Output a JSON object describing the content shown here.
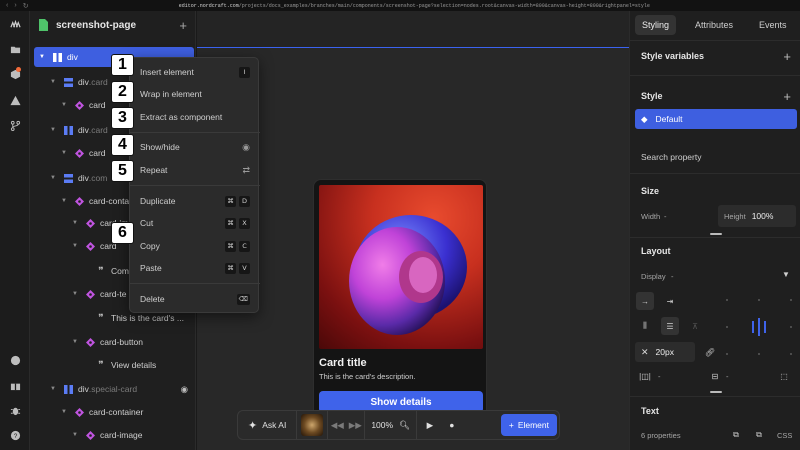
{
  "browser": {
    "url_prefix": "editor.nordcraft.com",
    "url_rest": "/projects/docs_examples/branches/main/components/screenshot-page?selection=nodes.root&canvas-width=800&canvas-height=800&rightpanel=style"
  },
  "rail": {
    "icons": [
      "nordcraft-logo-icon",
      "files-icon",
      "package-icon",
      "warning-icon",
      "branch-icon",
      "theme-icon",
      "gift-icon",
      "bug-icon",
      "help-icon"
    ]
  },
  "tree": {
    "page_name": "screenshot-page",
    "rows": [
      {
        "name": "div",
        "cls": "",
        "sel": true
      },
      {
        "name": "div",
        "cls": ".card"
      },
      {
        "name": "card",
        "cls": ""
      },
      {
        "name": "div",
        "cls": ".card"
      },
      {
        "name": "card",
        "cls": ""
      },
      {
        "name": "div",
        "cls": ".com"
      },
      {
        "name": "card-conta",
        "cls": ""
      },
      {
        "name": "card-im",
        "cls": ""
      },
      {
        "name": "card",
        "cls": ""
      },
      {
        "name": "Comp",
        "cls": ""
      },
      {
        "name": "card-te",
        "cls": ""
      },
      {
        "name": "This is the card's ...",
        "cls": ""
      },
      {
        "name": "card-button",
        "cls": ""
      },
      {
        "name": "View details",
        "cls": ""
      },
      {
        "name": "div",
        "cls": ".special-card"
      },
      {
        "name": "card-container",
        "cls": ""
      },
      {
        "name": "card-image",
        "cls": ""
      }
    ]
  },
  "context_menu": {
    "insert": "Insert element",
    "insert_key": "I",
    "wrap": "Wrap in element",
    "extract": "Extract as component",
    "showhide": "Show/hide",
    "repeat": "Repeat",
    "duplicate": "Duplicate",
    "cut": "Cut",
    "copy": "Copy",
    "paste": "Paste",
    "delete": "Delete",
    "cmd": "⌘",
    "key_d": "D",
    "key_x": "X",
    "key_c": "C",
    "key_v": "V",
    "key_del": "⌫"
  },
  "badges": [
    "1",
    "2",
    "3",
    "4",
    "5",
    "6"
  ],
  "card": {
    "title": "Card title",
    "description": "This is the card's description.",
    "button": "Show details"
  },
  "toolbar": {
    "ask_ai": "Ask AI",
    "zoom": "100%",
    "element": "Element"
  },
  "right_panel": {
    "tabs": [
      "Styling",
      "Attributes",
      "Events"
    ],
    "style_variables": "Style variables",
    "style": "Style",
    "default": "Default",
    "search": "Search property",
    "size": "Size",
    "width_label": "Width",
    "width_value": "-",
    "height_label": "Height",
    "height_value": "100%",
    "layout": "Layout",
    "display_label": "Display",
    "display_value": "-",
    "gap_value": "20px",
    "pad_left": "-",
    "pad_mid": "-",
    "text": "Text",
    "text_props": "6 properties",
    "css": "CSS"
  },
  "colors": {
    "accent": "#3f63ea",
    "selection": "#3e5fe0",
    "element_icon": "#c054e0",
    "div_icon": "#5b7cf5",
    "page_icon": "#4fc36a"
  }
}
